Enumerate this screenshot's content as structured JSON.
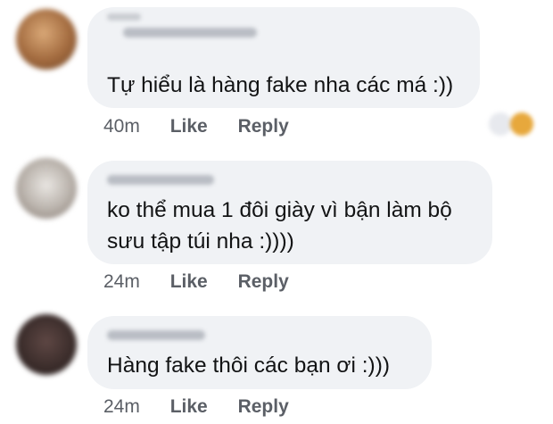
{
  "comments": [
    {
      "text": "Tự hiểu là hàng fake nha các má :))",
      "time": "40m",
      "like": "Like",
      "reply": "Reply",
      "avatar_color": "#b07a4a"
    },
    {
      "text_line1": "ko thể mua 1 đôi giày vì bận làm bộ",
      "text_line2": "sưu tập túi nha :))))",
      "time": "24m",
      "like": "Like",
      "reply": "Reply",
      "avatar_color": "#9aa1a8"
    },
    {
      "text": "Hàng fake thôi các bạn ơi :)))",
      "time": "24m",
      "like": "Like",
      "reply": "Reply",
      "avatar_color": "#3a2c2a"
    }
  ],
  "colors": {
    "bubble": "#f0f2f5",
    "text": "#121314",
    "meta": "#5b5f66"
  }
}
